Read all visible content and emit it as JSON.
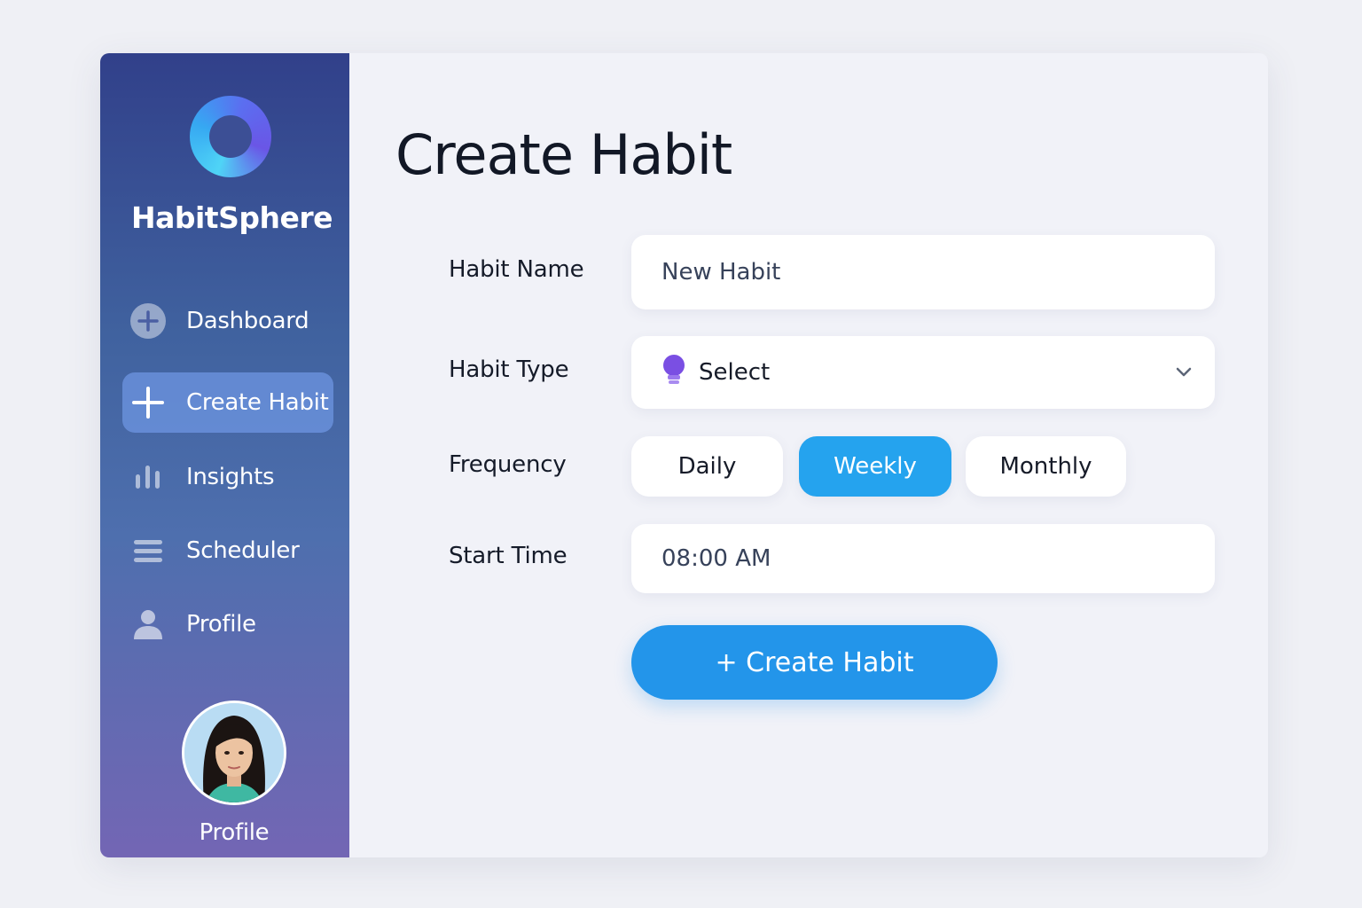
{
  "sidebar": {
    "brand": "HabitSphere",
    "items": [
      {
        "label": "Dashboard",
        "icon": "plus-circle-icon",
        "active": false
      },
      {
        "label": "Create Habit",
        "icon": "plus-icon",
        "active": true
      },
      {
        "label": "Insights",
        "icon": "bar-chart-icon",
        "active": false
      },
      {
        "label": "Scheduler",
        "icon": "list-icon",
        "active": false
      },
      {
        "label": "Profile",
        "icon": "user-icon",
        "active": false
      }
    ],
    "avatar_caption": "Profile"
  },
  "main": {
    "title": "Create Habit",
    "habit_name": {
      "label": "Habit Name",
      "value": "New Habit"
    },
    "habit_type": {
      "label": "Habit Type",
      "value": "Select",
      "icon": "bulb-icon"
    },
    "frequency": {
      "label": "Frequency",
      "options": [
        "Daily",
        "Weekly",
        "Monthly"
      ],
      "selected": "Weekly"
    },
    "start_time": {
      "label": "Start Time",
      "value": "08:00 AM"
    },
    "create_button": "+ Create Habit"
  },
  "colors": {
    "accent": "#2395ea",
    "selected_option": "#25a3ee",
    "sidebar_top": "#31408a",
    "sidebar_bottom": "#7366b4"
  }
}
